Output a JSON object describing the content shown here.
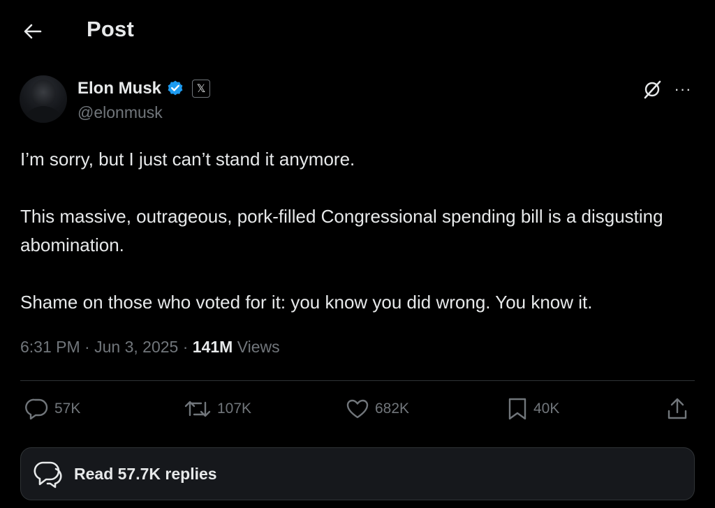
{
  "header": {
    "title": "Post",
    "back_icon": "arrow-left-icon"
  },
  "author": {
    "display_name": "Elon Musk",
    "handle": "@elonmusk",
    "verified_icon": "verified-badge-icon",
    "affiliation_badge": "𝕏",
    "grok_icon": "grok-icon",
    "more_icon": "more-options-icon",
    "more_label": "···"
  },
  "post": {
    "paragraphs": [
      "I’m sorry, but I just can’t stand it anymore.",
      "This massive, outrageous, pork-filled Congressional spending bill is a disgusting abomination.",
      "Shame on those who voted for it: you know you did wrong. You know it."
    ],
    "time": "6:31 PM",
    "separator": "·",
    "date": "Jun 3, 2025",
    "views_count": "141M",
    "views_label": "Views"
  },
  "actions": {
    "replies": "57K",
    "reposts": "107K",
    "likes": "682K",
    "bookmarks": "40K"
  },
  "read_replies": {
    "label": "Read 57.7K replies"
  },
  "colors": {
    "background": "#000000",
    "text_primary": "#e7e9ea",
    "text_secondary": "#71767b",
    "verified_blue": "#1d9bf0",
    "divider": "#2f3336",
    "card_background": "#16181c"
  }
}
